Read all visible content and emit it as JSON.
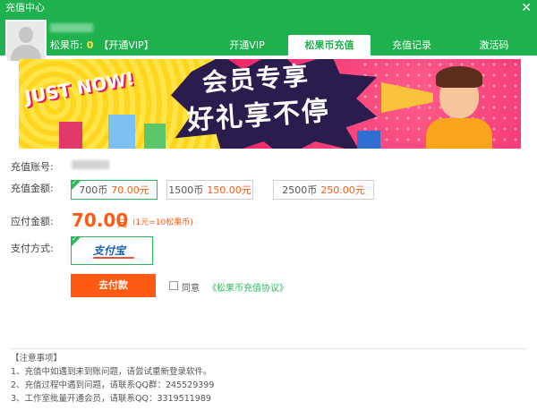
{
  "window": {
    "title": "充值中心",
    "close_icon": "close-icon"
  },
  "header": {
    "coins_label": "松果币:",
    "coins_value": "0",
    "vip_link": "【开通VIP】",
    "tabs": [
      {
        "label": "开通VIP",
        "active": false
      },
      {
        "label": "松果币充值",
        "active": true
      },
      {
        "label": "充值记录",
        "active": false
      },
      {
        "label": "激活码",
        "active": false
      }
    ]
  },
  "banner": {
    "tagline": "JUST NOW!",
    "headline_1": "会员专享",
    "headline_2": "好礼享不停"
  },
  "form": {
    "account_label": "充值账号:",
    "amount_label": "充值金额:",
    "amounts": [
      {
        "coins": "700币",
        "price": "70.00元",
        "selected": true
      },
      {
        "coins": "1500币",
        "price": "150.00元",
        "selected": false
      },
      {
        "coins": "2500币",
        "price": "250.00元",
        "selected": false
      }
    ],
    "payable_label": "应付金额:",
    "payable_value": "70.00",
    "payable_unit": "元",
    "rate_note": "(1元=10松果币)",
    "method_label": "支付方式:",
    "method_name": "支付宝",
    "pay_button": "去付款",
    "agree_text": "同意",
    "agreement_link": "《松果币充值协议》"
  },
  "notes": {
    "title": "【注意事项】",
    "items": [
      "1、充值中如遇到未到账问题，请尝试重新登录软件。",
      "2、充值过程中遇到问题，请联系QQ群：245529399",
      "3、工作室批量开通会员，请联系QQ：3319511989"
    ]
  },
  "colors": {
    "brand_green": "#1fb14d",
    "accent_orange": "#ff5a14"
  }
}
